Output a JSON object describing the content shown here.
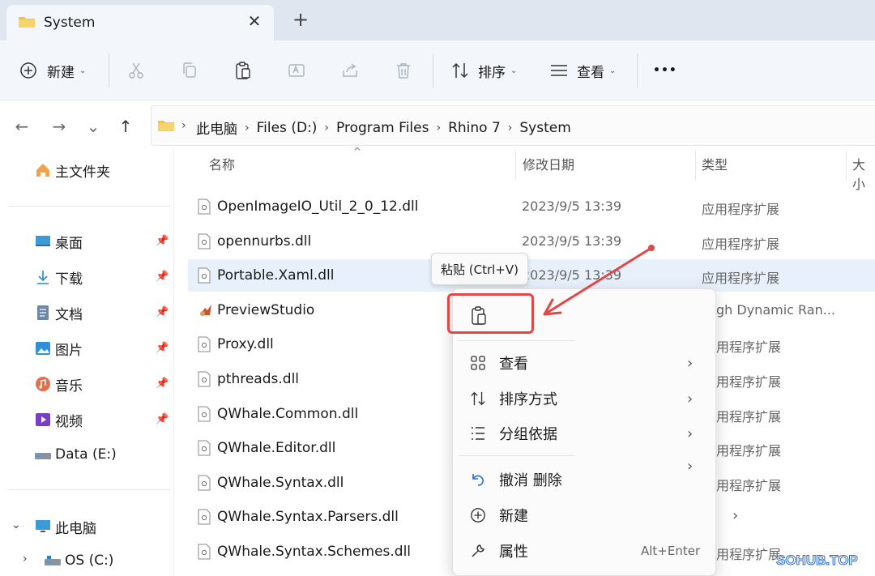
{
  "tab": {
    "title": "System",
    "close": "✕",
    "new_tab": "+"
  },
  "toolbar": {
    "new_label": "新建",
    "sort_label": "排序",
    "view_label": "查看",
    "more": "•••"
  },
  "nav": {
    "back": "←",
    "forward": "→",
    "recent": "⌄",
    "up": "↑"
  },
  "breadcrumb": [
    "此电脑",
    "Files (D:)",
    "Program Files",
    "Rhino 7",
    "System"
  ],
  "sidebar": {
    "home": "主文件夹",
    "quick": [
      {
        "label": "桌面"
      },
      {
        "label": "下载"
      },
      {
        "label": "文档"
      },
      {
        "label": "图片"
      },
      {
        "label": "音乐"
      },
      {
        "label": "视频"
      },
      {
        "label": "Data (E:)"
      }
    ],
    "this_pc": "此电脑",
    "os_drive": "OS (C:)"
  },
  "columns": {
    "name": "名称",
    "modified": "修改日期",
    "type": "类型",
    "size": "大小"
  },
  "files": [
    {
      "name": "OpenImageIO_Util_2_0_12.dll",
      "date": "2023/9/5 13:39",
      "type": "应用程序扩展"
    },
    {
      "name": "opennurbs.dll",
      "date": "2023/9/5 13:39",
      "type": "应用程序扩展"
    },
    {
      "name": "Portable.Xaml.dll",
      "date": "2023/9/5 13:39",
      "type": "应用程序扩展"
    },
    {
      "name": "PreviewStudio",
      "date": "",
      "type": "gh Dynamic Ran..."
    },
    {
      "name": "Proxy.dll",
      "date": "",
      "type": "用程序扩展"
    },
    {
      "name": "pthreads.dll",
      "date": "",
      "type": "用程序扩展"
    },
    {
      "name": "QWhale.Common.dll",
      "date": "",
      "type": "用程序扩展"
    },
    {
      "name": "QWhale.Editor.dll",
      "date": "",
      "type": "用程序扩展"
    },
    {
      "name": "QWhale.Syntax.dll",
      "date": "",
      "type": "用程序扩展"
    },
    {
      "name": "QWhale.Syntax.Parsers.dll",
      "date": "",
      "type": ""
    },
    {
      "name": "QWhale.Syntax.Schemes.dll",
      "date": "",
      "type": "用程序扩展"
    }
  ],
  "tooltip": "粘贴 (Ctrl+V)",
  "context_menu": {
    "view": "查看",
    "sort": "排序方式",
    "group": "分组依据",
    "undo": "撤消 删除",
    "new": "新建",
    "properties": "属性",
    "properties_shortcut": "Alt+Enter",
    "chevron": "›"
  },
  "watermark": "SOHUB.TOP",
  "colors": {
    "accent": "#2b6cc4",
    "highlight": "#e04848",
    "selected_row": "#e8f1fb"
  }
}
